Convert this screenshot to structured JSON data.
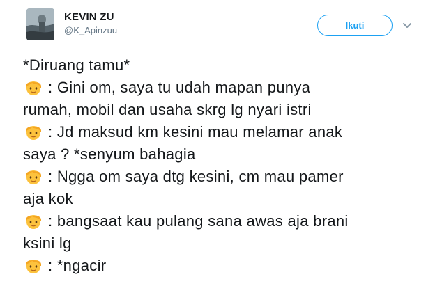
{
  "user": {
    "display_name": "KEVIN ZU",
    "username": "@K_Apinzuu"
  },
  "actions": {
    "follow_label": "Ikuti",
    "caret_icon": "chevron-down-icon"
  },
  "tweet": {
    "emoji_icon": "boy-face-emoji",
    "lines": [
      "*Diruang tamu*",
      ": Gini om, saya tu udah mapan punya",
      "rumah, mobil dan usaha skrg lg nyari istri",
      ": Jd maksud km kesini mau melamar anak",
      "saya ? *senyum bahagia",
      ": Ngga om saya dtg kesini, cm mau pamer",
      "aja kok",
      ": bangsaat kau pulang sana awas aja brani",
      "ksini lg",
      ": *ngacir"
    ]
  },
  "colors": {
    "accent": "#1da1f2",
    "secondary_text": "#657786",
    "primary_text": "#14171a"
  }
}
